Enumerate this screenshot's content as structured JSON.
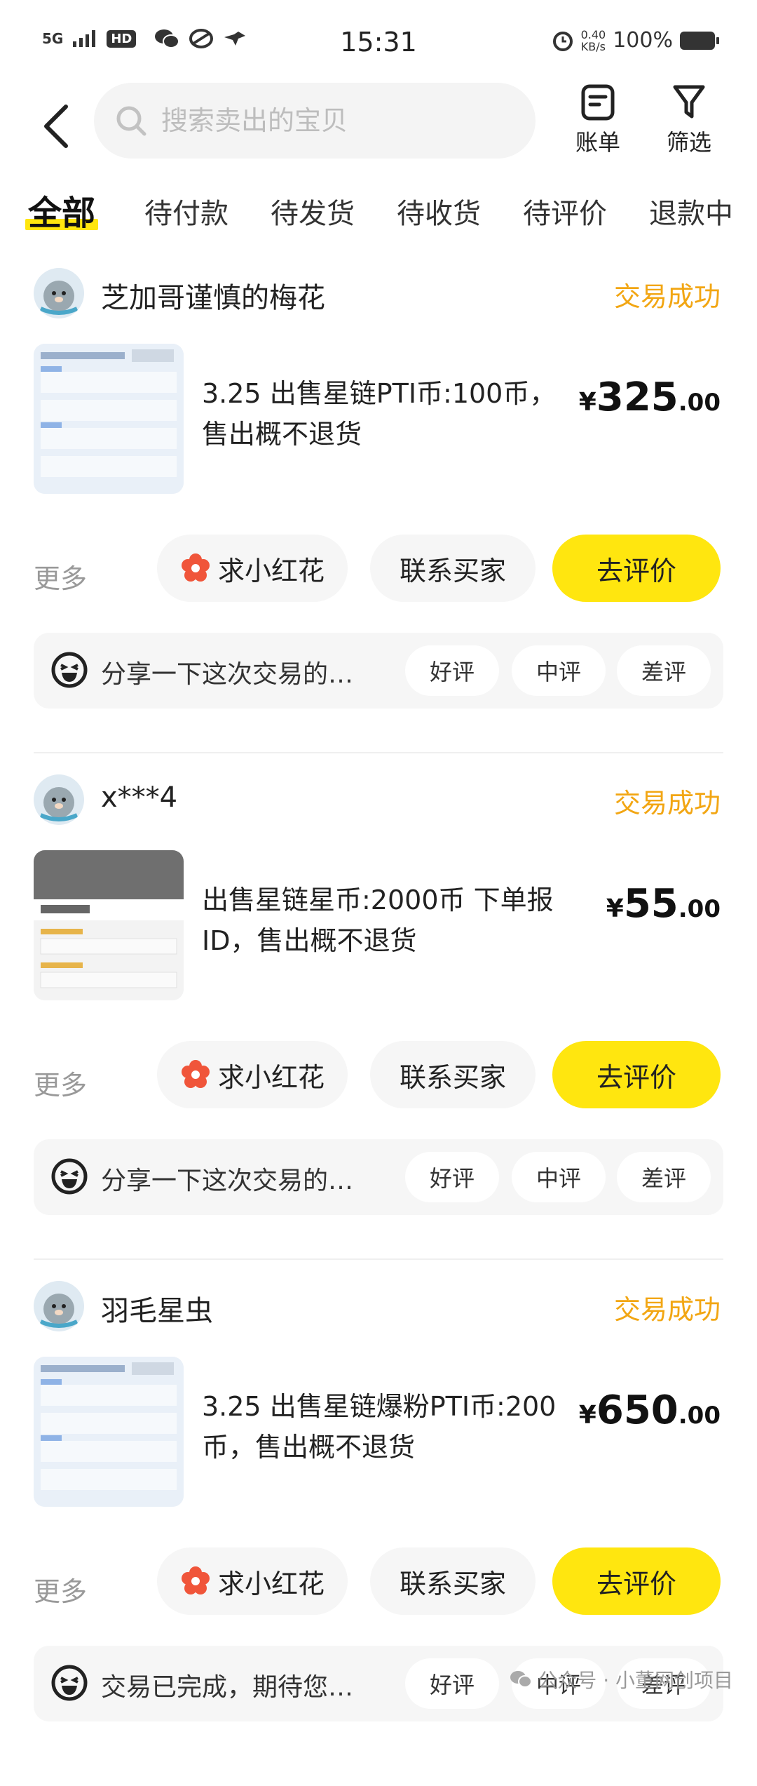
{
  "status_bar": {
    "network": "5G",
    "hd": "HD",
    "time": "15:31",
    "speed_value": "0.40",
    "speed_unit": "KB/s",
    "battery": "100%"
  },
  "header": {
    "search_placeholder": "搜索卖出的宝贝",
    "bill_label": "账单",
    "filter_label": "筛选"
  },
  "tabs": [
    "全部",
    "待付款",
    "待发货",
    "待收货",
    "待评价",
    "退款中"
  ],
  "orders": [
    {
      "buyer": "芝加哥谨慎的梅花",
      "status": "交易成功",
      "title": "3.25 出售星链PTI币:100币，售出概不退货",
      "price_currency": "¥",
      "price_int": "325",
      "price_dec": ".00",
      "more": "更多",
      "flower_label": "求小红花",
      "contact_label": "联系买家",
      "review_label": "去评价",
      "rate_prompt": "分享一下这次交易的…",
      "rate_good": "好评",
      "rate_mid": "中评",
      "rate_bad": "差评"
    },
    {
      "buyer": "x***4",
      "status": "交易成功",
      "title": "出售星链星币:2000币 下单报ID，售出概不退货",
      "price_currency": "¥",
      "price_int": "55",
      "price_dec": ".00",
      "more": "更多",
      "flower_label": "求小红花",
      "contact_label": "联系买家",
      "review_label": "去评价",
      "rate_prompt": "分享一下这次交易的…",
      "rate_good": "好评",
      "rate_mid": "中评",
      "rate_bad": "差评"
    },
    {
      "buyer": "羽毛星虫",
      "status": "交易成功",
      "title": "3.25 出售星链爆粉PTI币:200币，售出概不退货",
      "price_currency": "¥",
      "price_int": "650",
      "price_dec": ".00",
      "more": "更多",
      "flower_label": "求小红花",
      "contact_label": "联系买家",
      "review_label": "去评价",
      "rate_prompt": "交易已完成，期待您…",
      "rate_good": "好评",
      "rate_mid": "中评",
      "rate_bad": "差评"
    }
  ],
  "watermark": "公众号 · 小董网创项目",
  "colors": {
    "accent_yellow": "#ffe60f",
    "status_orange": "#f2a613",
    "pill_bg": "#f6f6f6",
    "flower_red": "#f0553a"
  }
}
